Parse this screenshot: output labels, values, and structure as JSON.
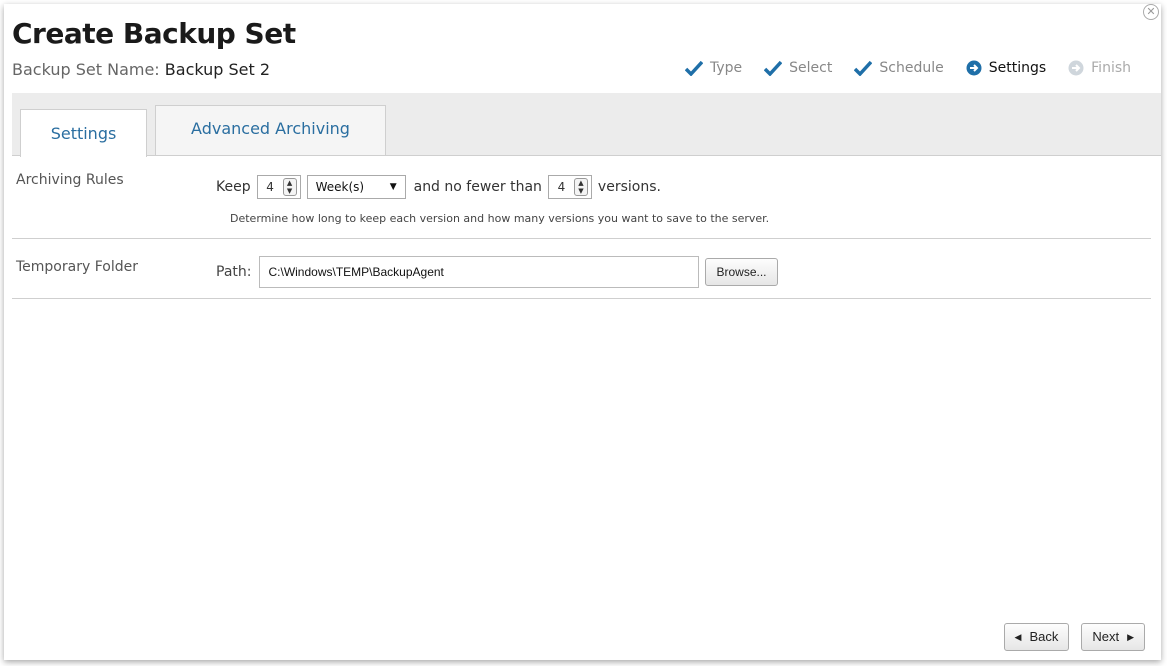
{
  "dialog": {
    "title": "Create Backup Set",
    "close_glyph": "✕"
  },
  "backup_set": {
    "label": "Backup Set Name:",
    "value": "Backup Set 2"
  },
  "wizard_steps": [
    {
      "label": "Type",
      "state": "done"
    },
    {
      "label": "Select",
      "state": "done"
    },
    {
      "label": "Schedule",
      "state": "done"
    },
    {
      "label": "Settings",
      "state": "active"
    },
    {
      "label": "Finish",
      "state": "pending"
    }
  ],
  "tabs": [
    {
      "label": "Settings",
      "selected": true
    },
    {
      "label": "Advanced Archiving",
      "selected": false
    }
  ],
  "archiving": {
    "label": "Archiving Rules",
    "keep_text": "Keep",
    "keep_value": "4",
    "unit_value": "Week(s)",
    "middle_text": "and no fewer than",
    "versions_value": "4",
    "versions_text": "versions.",
    "help": "Determine how long to keep each version and how many versions you want to save to the server."
  },
  "temp_folder": {
    "label": "Temporary Folder",
    "path_label": "Path:",
    "path_value": "C:\\Windows\\TEMP\\BackupAgent",
    "browse_label": "Browse..."
  },
  "nav": {
    "back_label": "Back",
    "next_label": "Next"
  },
  "colors": {
    "accent": "#1f6fa8",
    "tab_text": "#2a6ea0"
  }
}
